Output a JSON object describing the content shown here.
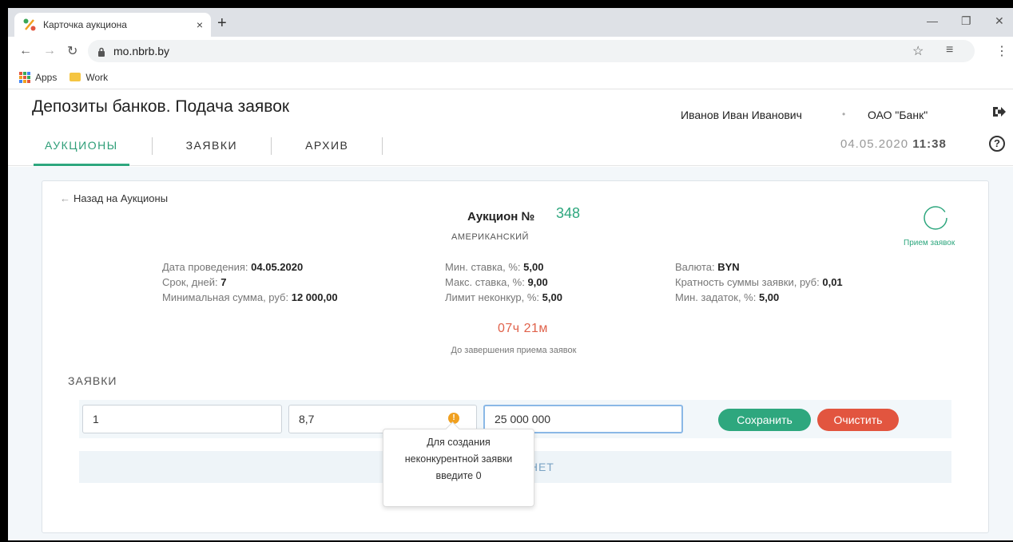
{
  "browser": {
    "tab_title": "Карточка аукциона",
    "tab_close": "×",
    "new_tab": "+",
    "url": "mo.nbrb.by",
    "bookmarks": [
      {
        "label": "Apps"
      },
      {
        "label": "Work"
      }
    ]
  },
  "header": {
    "title": "Депозиты банков. Подача заявок",
    "user_name": "Иванов Иван Иванович",
    "bank_name": "ОАО \"Банк\"",
    "date": "04.05.2020",
    "time": "11:38",
    "help": "?",
    "tabs": [
      {
        "label": "АУКЦИОНЫ",
        "active": true
      },
      {
        "label": "ЗАЯВКИ",
        "active": false
      },
      {
        "label": "АРХИВ",
        "active": false
      }
    ]
  },
  "auction": {
    "back_label": "Назад на Аукционы",
    "title_label": "Аукцион №",
    "number": "348",
    "type": "АМЕРИКАНСКИЙ",
    "status": "Прием заявок",
    "info": {
      "date_label": "Дата проведения:",
      "date_value": "04.05.2020",
      "term_label": "Срок, дней:",
      "term_value": "7",
      "min_sum_label": "Минимальная сумма, руб:",
      "min_sum_value": "12 000,00",
      "min_rate_label": "Мин. ставка, %:",
      "min_rate_value": "5,00",
      "max_rate_label": "Макс. ставка, %:",
      "max_rate_value": "9,00",
      "limit_label": "Лимит неконкур, %:",
      "limit_value": "5,00",
      "currency_label": "Валюта:",
      "currency_value": "BYN",
      "multiplicity_label": "Кратность суммы заявки, руб:",
      "multiplicity_value": "0,01",
      "deposit_label": "Мин. задаток, %:",
      "deposit_value": "5,00"
    },
    "timer": "07ч 21м",
    "timer_label": "До завершения приема заявок"
  },
  "bids": {
    "section_title": "ЗАЯВКИ",
    "fields": {
      "number": "1",
      "rate": "8,7",
      "amount": "25 000 000"
    },
    "save_label": "Сохранить",
    "clear_label": "Очистить",
    "empty_label": "ЗАЯВОК НЕТ",
    "tooltip_lines": [
      "Для создания",
      "неконкурентной заявки",
      "введите 0"
    ]
  },
  "colors": {
    "accent_green": "#2ea77e",
    "danger_red": "#e2553f",
    "timer_red": "#e0624b",
    "info_orange": "#f0a020"
  },
  "icons": [
    "favicon-percent-icon",
    "back-icon",
    "forward-icon",
    "reload-icon",
    "lock-icon",
    "star-icon",
    "reading-list-icon",
    "menu-icon",
    "apps-icon",
    "folder-icon",
    "logout-icon",
    "help-icon",
    "status-circle-icon",
    "info-icon"
  ]
}
